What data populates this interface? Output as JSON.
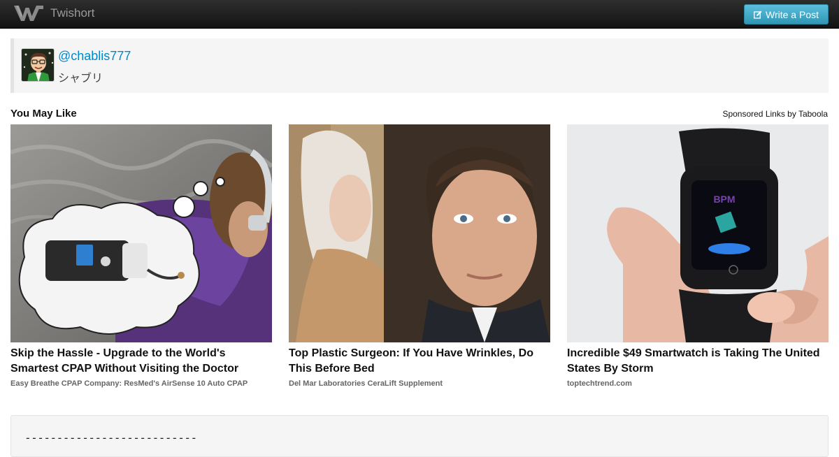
{
  "navbar": {
    "brand": "Twishort",
    "write_label": "Write a Post"
  },
  "profile": {
    "handle": "@chablis777",
    "display_name": "シャブリ"
  },
  "recommendations": {
    "heading": "You May Like",
    "sponsored_label": "Sponsored Links by Taboola",
    "items": [
      {
        "title": "Skip the Hassle - Upgrade to the World's Smartest CPAP Without Visiting the Doctor",
        "source": "Easy Breathe CPAP Company: ResMed's AirSense 10 Auto CPAP"
      },
      {
        "title": "Top Plastic Surgeon: If You Have Wrinkles, Do This Before Bed",
        "source": "Del Mar Laboratories CeraLift Supplement"
      },
      {
        "title": "Incredible $49 Smartwatch is Taking The United States By Storm",
        "source": "toptechtrend.com",
        "watch_screen_text": "BPM"
      }
    ]
  },
  "post": {
    "text": "---------------------------"
  },
  "colors": {
    "navbar": "#1b1b1b",
    "button": "#49afcd",
    "link": "#0088cc"
  },
  "icons": {
    "logo": "twishort-logo-icon",
    "edit": "edit-icon"
  }
}
